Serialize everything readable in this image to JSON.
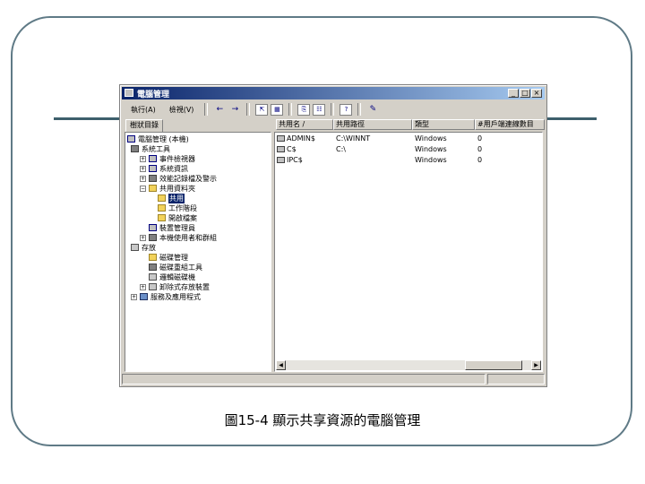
{
  "window": {
    "title": "電腦管理",
    "controls": {
      "minimize": "_",
      "maximize": "□",
      "close": "×"
    }
  },
  "menu": [
    {
      "label": "執行(A)"
    },
    {
      "label": "檢視(V)"
    }
  ],
  "toolbar": {
    "back": "←",
    "forward": "→",
    "up": "⇱",
    "show_tree": "▦",
    "export": "⎘",
    "properties": "☷",
    "help": "?",
    "refresh": "✎"
  },
  "tree": {
    "tab_label": "樹狀目錄",
    "items": [
      {
        "label": "電腦管理 (本機)",
        "icon": "computer-icon",
        "expander": ""
      },
      {
        "label": "系統工具",
        "icon": "tools-icon",
        "expander": "−"
      },
      {
        "label": "事件檢視器",
        "icon": "event-viewer-icon",
        "expander": "+"
      },
      {
        "label": "系統資訊",
        "icon": "system-info-icon",
        "expander": "+"
      },
      {
        "label": "效能記錄檔及警示",
        "icon": "performance-icon",
        "expander": "+"
      },
      {
        "label": "共用資料夾",
        "icon": "shared-folder-icon",
        "expander": "−"
      },
      {
        "label": "共用",
        "icon": "share-icon",
        "expander": "",
        "selected": true
      },
      {
        "label": "工作階段",
        "icon": "folder-icon",
        "expander": ""
      },
      {
        "label": "開啟檔案",
        "icon": "folder-icon",
        "expander": ""
      },
      {
        "label": "裝置管理員",
        "icon": "device-manager-icon",
        "expander": ""
      },
      {
        "label": "本機使用者和群組",
        "icon": "users-icon",
        "expander": "+"
      },
      {
        "label": "存放",
        "icon": "storage-icon",
        "expander": "−"
      },
      {
        "label": "磁碟管理",
        "icon": "folder-icon",
        "expander": ""
      },
      {
        "label": "磁碟重組工具",
        "icon": "defrag-icon",
        "expander": ""
      },
      {
        "label": "邏輯磁碟機",
        "icon": "disk-icon",
        "expander": ""
      },
      {
        "label": "卸除式存放裝置",
        "icon": "removable-storage-icon",
        "expander": "+"
      },
      {
        "label": "服務及應用程式",
        "icon": "services-icon",
        "expander": "+"
      }
    ]
  },
  "list": {
    "columns": [
      "共用名 /",
      "共用路徑",
      "類型",
      "#用戶端連線數目"
    ],
    "rows": [
      {
        "name": "ADMIN$",
        "path": "C:\\WINNT",
        "type": "Windows",
        "clients": "0"
      },
      {
        "name": "C$",
        "path": "C:\\",
        "type": "Windows",
        "clients": "0"
      },
      {
        "name": "IPC$",
        "path": "",
        "type": "Windows",
        "clients": "0"
      }
    ],
    "scroll_left": "◀",
    "scroll_right": "▶"
  },
  "caption": "圖15-4 顯示共享資源的電腦管理"
}
